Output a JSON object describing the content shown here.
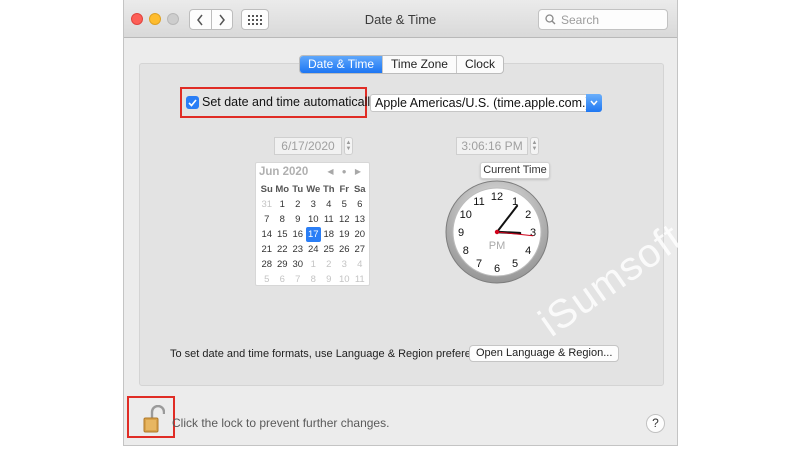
{
  "window": {
    "title": "Date & Time",
    "search_placeholder": "Search"
  },
  "tabs": [
    {
      "label": "Date & Time",
      "active": true
    },
    {
      "label": "Time Zone",
      "active": false
    },
    {
      "label": "Clock",
      "active": false
    }
  ],
  "auto": {
    "label": "Set date and time automatically:",
    "checked": true,
    "server": "Apple Americas/U.S. (time.apple.com.)"
  },
  "date_field": "6/17/2020",
  "time_field": "3:06:16 PM",
  "calendar": {
    "month": "Jun 2020",
    "weekdays": [
      "Su",
      "Mo",
      "Tu",
      "We",
      "Th",
      "Fr",
      "Sa"
    ],
    "days": [
      "31",
      "1",
      "2",
      "3",
      "4",
      "5",
      "6",
      "7",
      "8",
      "9",
      "10",
      "11",
      "12",
      "13",
      "14",
      "15",
      "16",
      "17",
      "18",
      "19",
      "20",
      "21",
      "22",
      "23",
      "24",
      "25",
      "26",
      "27",
      "28",
      "29",
      "30",
      "1",
      "2",
      "3",
      "4",
      "5",
      "6",
      "7",
      "8",
      "9",
      "10",
      "11"
    ],
    "selected": "17"
  },
  "clock": {
    "label": "Current Time",
    "numerals": [
      "12",
      "1",
      "2",
      "3",
      "4",
      "5",
      "6",
      "7",
      "8",
      "9",
      "10",
      "11"
    ],
    "meridiem": "PM",
    "hour": 3,
    "minute": 6,
    "second": 16
  },
  "formats_text": "To set date and time formats, use Language & Region preferences.",
  "open_lang_button": "Open Language & Region...",
  "lock_text": "Click the lock to prevent further changes.",
  "help": "?",
  "watermark": "iSumsoft",
  "colors": {
    "accent": "#2a7ef6",
    "highlight_box": "#e02c25"
  }
}
